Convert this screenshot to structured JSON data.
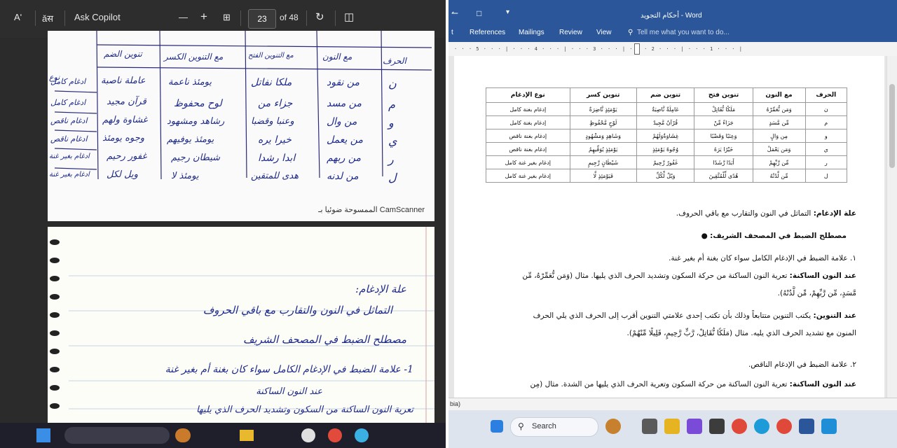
{
  "pdf_viewer": {
    "toolbar": {
      "read_aloud": "Aʹ",
      "translate": "ǎस",
      "ask_copilot": "Ask Copilot",
      "zoom_out": "—",
      "zoom_in": "+",
      "fit": "⊞",
      "page_current": "23",
      "page_total": "of 48",
      "rotate": "↻",
      "two_page": "◫"
    },
    "scan_page1": {
      "headers": [
        "الحرف",
        "مع النون",
        "مع التنوين الفتح",
        "مع التنوين الكسر",
        "تنوين الضم",
        "نوع"
      ],
      "rows": [
        [
          "ن",
          "من نقود",
          "ملكا نفاتل",
          "يومئذ ناعمة",
          "عاملة ناصبة",
          "ادغام كامل"
        ],
        [
          "م",
          "من مسد",
          "جزاء من",
          "لوح محفوظ",
          "قرآن مجيد",
          "ادغام كامل"
        ],
        [
          "و",
          "من وال",
          "وعنبا وقضبا",
          "رشاهد ومشهود",
          "غشاوة ولهم",
          "ادغام ناقص"
        ],
        [
          "ي",
          "من يعمل",
          "خيرا يره",
          "يومئذ يوفيهم",
          "وجوه يومئذ",
          "ادغام ناقص"
        ],
        [
          "ر",
          "من ربهم",
          "ابدا رشدا",
          "شيطان رجيم",
          "غفور رحيم",
          "ادغام بغير غنة"
        ],
        [
          "ل",
          "من لدنه",
          "هدى للمتقين",
          "يومئذ لا",
          "ويل لكل",
          "ادغام بغير غنة"
        ]
      ],
      "camscanner_label": "الممسوحة ضوئيا بـ CamScanner"
    },
    "scan_page2": {
      "lines": [
        "علة الإدغام:",
        "التماثل في النون والتقارب مع باقي الحروف",
        "مصطلح الضبط في المصحف الشريف",
        "1- علامة الضبط في الإدغام الكامل سواء كان بغنة أم بغير غنة",
        "عند النون الساكنة",
        "تعرية النون الساكنة من السكون وتشديد الحرف الذي يليها"
      ]
    }
  },
  "word": {
    "title": "أحكام التجويد - Word",
    "ribbon_tabs": [
      "t",
      "References",
      "Mailings",
      "Review",
      "View"
    ],
    "tell_me": "Tell me what you want to do...",
    "table": {
      "headers": [
        "الحرف",
        "مع النون",
        "تنوين فتح",
        "تنوين ضم",
        "تنوين كسر",
        "نوع الإدغام"
      ],
      "rows": [
        [
          "ن",
          "وَمَن نُّعَمِّرْهُ",
          "مَلَكًا نُّقَاتِلْ",
          "عَامِلَةٌ نَّاصِبَةٌ",
          "يَوْمَئِذٍ نَّاضِرَةٌ",
          "إدغام بغنة كامل"
        ],
        [
          "م",
          "مِّن مَّسَدٍ",
          "جَزَاءً مِّنْ",
          "قُرْآنٌ مَّجِيدٌ",
          "لَوْحٍ مَّحْفُوظٍ",
          "إدغام بغنة كامل"
        ],
        [
          "و",
          "مِن وَالٍ",
          "وَعِنَبًا وَقَضْبًا",
          "غِشَاوَةٌوَلَهُمْ",
          "وَشَاهِدٍ وَمَشْهُودٍ",
          "إدغام بغنة ناقص"
        ],
        [
          "ي",
          "وَمَن يَعْمَلْ",
          "خَيْرًا يَرَهُ",
          "وُجُوهٌ يَوْمَئِذٍ",
          "يَوْمَئِذٍ يُوَفِّيهِمُ",
          "إدغام بغنة ناقص"
        ],
        [
          "ر",
          "مِّن رَّبِّهِمْ",
          "أَبَدًا رَّشَدًا",
          "غَفُورٌ رَّحِيمٌ",
          "شَيْطَانٍ رَّجِيمٍ",
          "إدغام بغير غنة كامل"
        ],
        [
          "ل",
          "مِّن لَّدُنْهُ",
          "هُدًى لِّلْمُتَّقِينَ",
          "وَيْلٌ لِّكُلِّ",
          "فَيَوْمَئِذٍ لَّا",
          "إدغام بغير غنة كامل"
        ]
      ]
    },
    "para1_bold": "علة الإدغام:",
    "para1_text": " التماثل في النون والتقارب مع باقي الحروف.",
    "bullet": "مصطلح الضبط في المصحف الشريف:",
    "item1": "١. علامة الضبط في الإدغام الكامل سواء كان بغنة أم بغير غنة.",
    "para2_bold": "عند النون الساكنة:",
    "para2_text": " تعرية النون الساكنة من حركة السكون وتشديد الحرف الذي يليها. مثال (وَمَن نُّعَمِّرْهُ، مِّن",
    "para2_line2": "مَّسَدٍ، مِّن رَّبِّهِمْ، مِّن لَّدُنْهُ).",
    "para3_bold": "عند التنوين:",
    "para3_text": " يكتب التنوين متتابعاً وذلك بأن تكتب إحدى علامتي التنوين أقرب إلى الحرف الذي يلي الحرف",
    "para3_line2": "المنون مع تشديد الحرف الذي يليه. مثال (مَلَكًا نُّقَاتِلْ، رَّبٍّ رَّحِيمٍ، قَلِيلًا مِّنْهُمْ).",
    "item2": "٢. علامة الضبط في الإدغام الناقص.",
    "para4_bold": "عند النون الساكنة:",
    "para4_text": " تعرية النون الساكنة من حركة السكون وتعرية الحرف الذي يليها من الشدة.  مثال (مِن",
    "status": "bia)",
    "taskbar_search": "Search"
  },
  "colors": {
    "word_blue": "#2b579a",
    "ink_blue": "#1e2a8a"
  }
}
